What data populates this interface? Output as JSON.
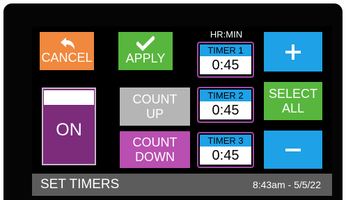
{
  "buttons": {
    "cancel": "CANCEL",
    "apply": "APPLY",
    "on": "ON",
    "count_up_line1": "COUNT",
    "count_up_line2": "UP",
    "count_down_line1": "COUNT",
    "count_down_line2": "DOWN",
    "select_all_line1": "SELECT",
    "select_all_line2": "ALL"
  },
  "header_label": "HR:MIN",
  "timers": [
    {
      "label": "TIMER 1",
      "value": "0:45"
    },
    {
      "label": "TIMER 2",
      "value": "0:45"
    },
    {
      "label": "TIMER 3",
      "value": "0:45"
    }
  ],
  "status": {
    "title": "SET TIMERS",
    "datetime": "8:43am - 5/5/22"
  },
  "icons": {
    "cancel": "undo-arrow-icon",
    "apply": "checkmark-icon",
    "increment": "plus-icon",
    "decrement": "minus-icon"
  },
  "colors": {
    "orange": "#f0883d",
    "green": "#58b63e",
    "blue": "#1ea1e6",
    "purple": "#7c2c7b",
    "magenta": "#b94fb0",
    "gray": "#b5b5b5",
    "status_bar": "#5c5c5c"
  }
}
